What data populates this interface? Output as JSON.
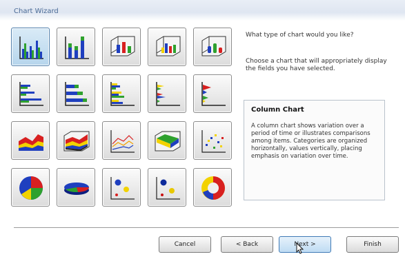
{
  "window": {
    "title": "Chart Wizard"
  },
  "chart_types": [
    {
      "name": "Column Chart",
      "icon": "column-chart-icon",
      "selected": true
    },
    {
      "name": "Stacked Column Chart",
      "icon": "stacked-column-icon",
      "selected": false
    },
    {
      "name": "3-D Column Chart",
      "icon": "column-3d-icon",
      "selected": false
    },
    {
      "name": "3-D Clustered Column Chart",
      "icon": "clustered-column-3d-icon",
      "selected": false
    },
    {
      "name": "3-D Cylinder Chart",
      "icon": "cylinder-3d-icon",
      "selected": false
    },
    {
      "name": "Bar Chart",
      "icon": "bar-chart-icon",
      "selected": false
    },
    {
      "name": "Stacked Bar Chart",
      "icon": "stacked-bar-icon",
      "selected": false
    },
    {
      "name": "Clustered Bar Chart",
      "icon": "clustered-bar-icon",
      "selected": false
    },
    {
      "name": "3-D Bar Chart",
      "icon": "bar-3d-icon",
      "selected": false
    },
    {
      "name": "3-D Cone Bar Chart",
      "icon": "cone-bar-icon",
      "selected": false
    },
    {
      "name": "Area Chart",
      "icon": "area-chart-icon",
      "selected": false
    },
    {
      "name": "3-D Area Chart",
      "icon": "area-3d-icon",
      "selected": false
    },
    {
      "name": "Line Chart",
      "icon": "line-chart-icon",
      "selected": false
    },
    {
      "name": "3-D Surface Chart",
      "icon": "surface-3d-icon",
      "selected": false
    },
    {
      "name": "XY Scatter Chart",
      "icon": "scatter-chart-icon",
      "selected": false
    },
    {
      "name": "Pie Chart",
      "icon": "pie-chart-icon",
      "selected": false
    },
    {
      "name": "3-D Pie Chart",
      "icon": "pie-3d-icon",
      "selected": false
    },
    {
      "name": "Bubble Chart",
      "icon": "bubble-chart-icon",
      "selected": false
    },
    {
      "name": "3-D Bubble Chart",
      "icon": "bubble-3d-icon",
      "selected": false
    },
    {
      "name": "Doughnut Chart",
      "icon": "doughnut-chart-icon",
      "selected": false
    }
  ],
  "prompt": {
    "question": "What type of chart would you like?",
    "instruction": "Choose a chart that will appropriately display the fields you have selected."
  },
  "description": {
    "title": "Column Chart",
    "body": "A column chart shows variation over a period of time or illustrates comparisons among items. Categories are organized horizontally, values vertically, placing emphasis on variation over time."
  },
  "buttons": {
    "cancel": "Cancel",
    "back": "< Back",
    "next": "Next >",
    "finish": "Finish"
  },
  "colors": {
    "blue": "#1f3fbf",
    "green": "#2ea12e",
    "red": "#d82020",
    "yellow": "#f2d200",
    "selected_tile": "#b6d5ec"
  }
}
